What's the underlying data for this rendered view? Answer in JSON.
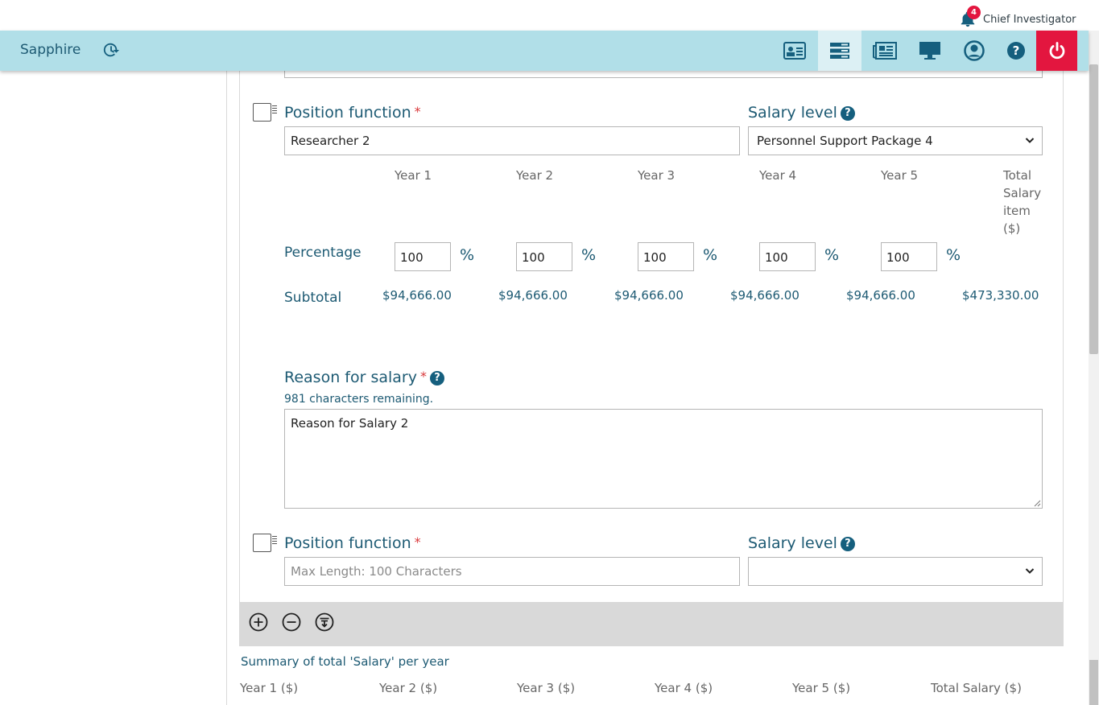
{
  "topbar": {
    "notification_count": "4",
    "role": "Chief Investigator"
  },
  "navbar": {
    "brand": "Sapphire",
    "buttons": [
      "id-card-icon",
      "list-icon",
      "newspaper-icon",
      "monitor-icon",
      "user-circle-icon",
      "help-icon",
      "power-icon"
    ],
    "power_color": "#e3163f"
  },
  "form": {
    "position_function_label": "Position function",
    "required_mark": "*",
    "salary_level_label": "Salary level",
    "help_glyph": "?",
    "entry1": {
      "position_function_value": "Researcher 2",
      "salary_level_value": "Personnel Support Package 4",
      "year_headers": [
        "Year 1",
        "Year 2",
        "Year 3",
        "Year 4",
        "Year 5"
      ],
      "total_header_lines": [
        "Total",
        "Salary",
        "item",
        "($)"
      ],
      "percentage_label": "Percentage",
      "percentages": [
        "100",
        "100",
        "100",
        "100",
        "100"
      ],
      "percent_sign": "%",
      "subtotal_label": "Subtotal",
      "subtotals": [
        "$94,666.00",
        "$94,666.00",
        "$94,666.00",
        "$94,666.00",
        "$94,666.00"
      ],
      "total": "$473,330.00",
      "reason_label": "Reason for salary",
      "reason_remaining": "981 characters remaining.",
      "reason_value": "Reason for Salary 2"
    },
    "entry2": {
      "position_function_placeholder": "Max Length: 100 Characters",
      "salary_level_value": ""
    }
  },
  "toolbar": {
    "icons": [
      "add-circle-icon",
      "remove-circle-icon",
      "filter-circle-icon"
    ]
  },
  "summary": {
    "title": "Summary of total 'Salary' per year",
    "headers": [
      "Year 1 ($)",
      "Year 2 ($)",
      "Year 3 ($)",
      "Year 4 ($)",
      "Year 5 ($)",
      "Total Salary ($)"
    ]
  }
}
